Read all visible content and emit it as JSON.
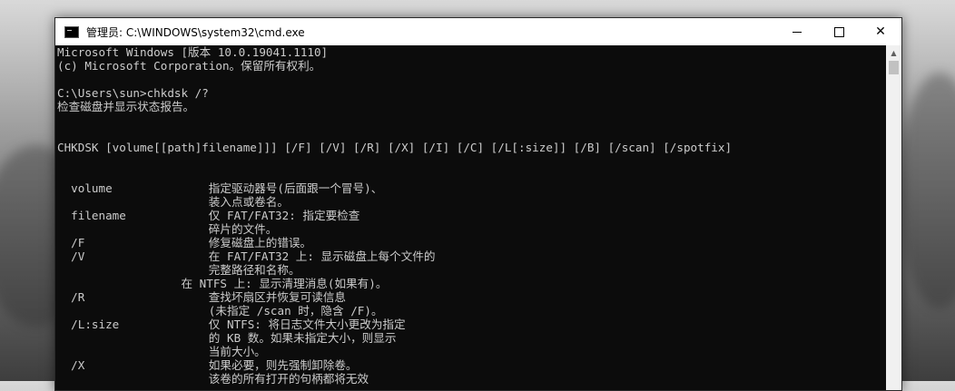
{
  "window": {
    "title": "管理员: C:\\WINDOWS\\system32\\cmd.exe",
    "controls": {
      "minimize": "—",
      "maximize": "☐",
      "close": "✕"
    }
  },
  "console": {
    "lines": [
      "Microsoft Windows [版本 10.0.19041.1110]",
      "(c) Microsoft Corporation。保留所有权利。",
      "",
      "C:\\Users\\sun>chkdsk /?",
      "检查磁盘并显示状态报告。",
      "",
      "",
      "CHKDSK [volume[[path]filename]]] [/F] [/V] [/R] [/X] [/I] [/C] [/L[:size]] [/B] [/scan] [/spotfix]",
      "",
      "",
      "  volume              指定驱动器号(后面跟一个冒号)、",
      "                      装入点或卷名。",
      "  filename            仅 FAT/FAT32: 指定要检查",
      "                      碎片的文件。",
      "  /F                  修复磁盘上的错误。",
      "  /V                  在 FAT/FAT32 上: 显示磁盘上每个文件的",
      "                      完整路径和名称。",
      "                  在 NTFS 上: 显示清理消息(如果有)。",
      "  /R                  查找坏扇区并恢复可读信息",
      "                      (未指定 /scan 时，隐含 /F)。",
      "  /L:size             仅 NTFS: 将日志文件大小更改为指定",
      "                      的 KB 数。如果未指定大小，则显示",
      "                      当前大小。",
      "  /X                  如果必要，则先强制卸除卷。",
      "                      该卷的所有打开的句柄都将无效"
    ]
  }
}
